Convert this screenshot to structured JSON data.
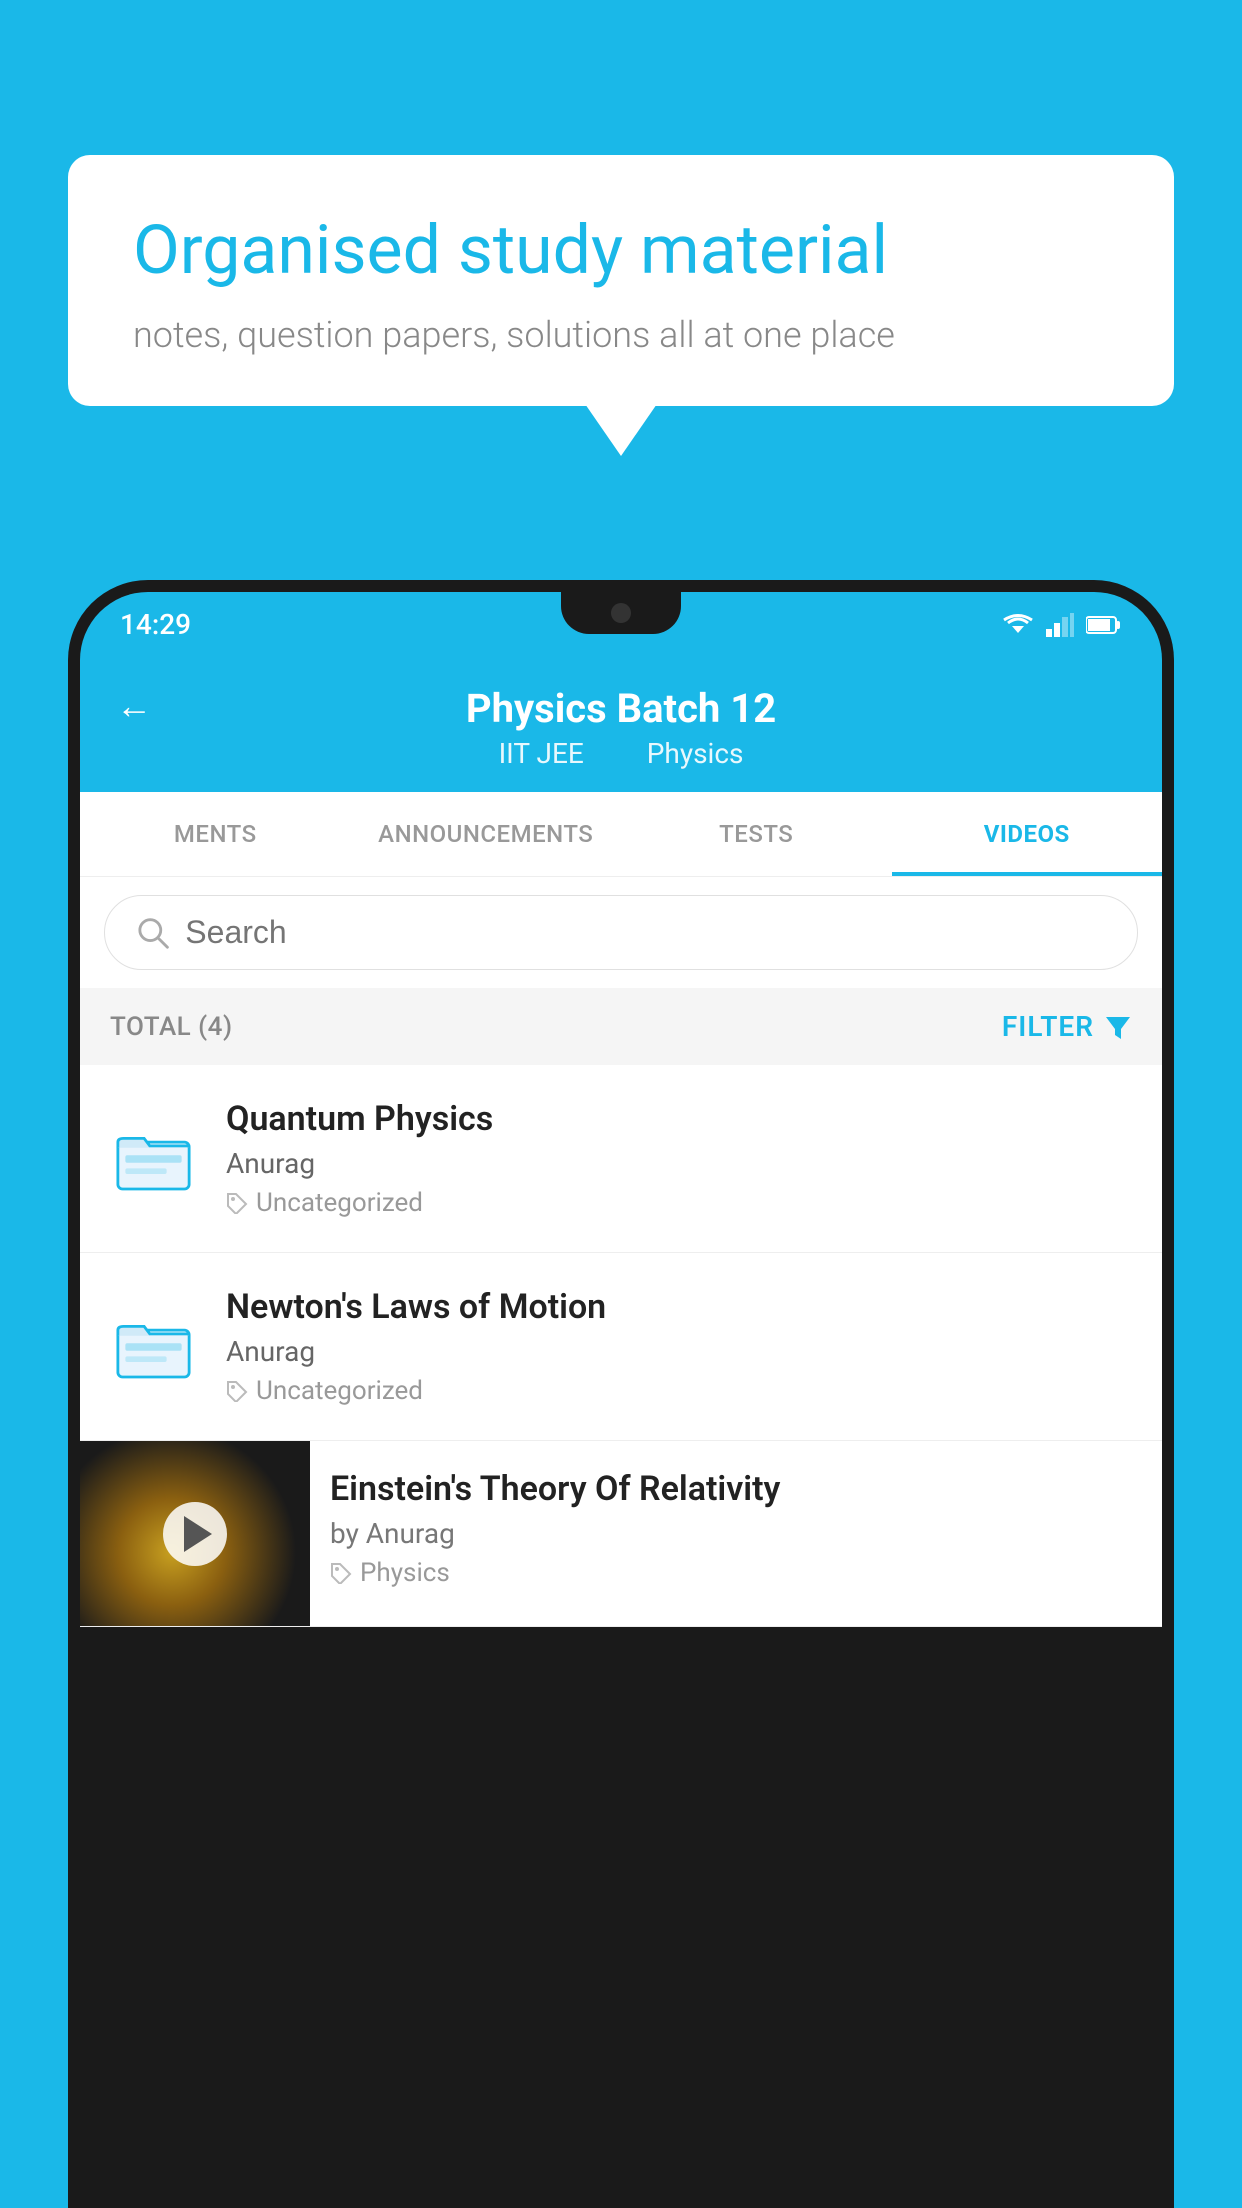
{
  "background": {
    "color": "#1ab8e8"
  },
  "speech_bubble": {
    "title": "Organised study material",
    "subtitle": "notes, question papers, solutions all at one place"
  },
  "phone": {
    "status_bar": {
      "time": "14:29"
    },
    "header": {
      "title": "Physics Batch 12",
      "subtitle_part1": "IIT JEE",
      "subtitle_part2": "Physics",
      "back_label": "←"
    },
    "tabs": [
      {
        "label": "MENTS",
        "active": false
      },
      {
        "label": "ANNOUNCEMENTS",
        "active": false
      },
      {
        "label": "TESTS",
        "active": false
      },
      {
        "label": "VIDEOS",
        "active": true
      }
    ],
    "search": {
      "placeholder": "Search"
    },
    "filter_row": {
      "total_label": "TOTAL (4)",
      "filter_label": "FILTER"
    },
    "videos": [
      {
        "id": "quantum",
        "title": "Quantum Physics",
        "author": "Anurag",
        "tag": "Uncategorized",
        "has_thumb": false
      },
      {
        "id": "newton",
        "title": "Newton's Laws of Motion",
        "author": "Anurag",
        "tag": "Uncategorized",
        "has_thumb": false
      },
      {
        "id": "einstein",
        "title": "Einstein's Theory Of Relativity",
        "author": "by Anurag",
        "tag": "Physics",
        "has_thumb": true
      }
    ]
  }
}
